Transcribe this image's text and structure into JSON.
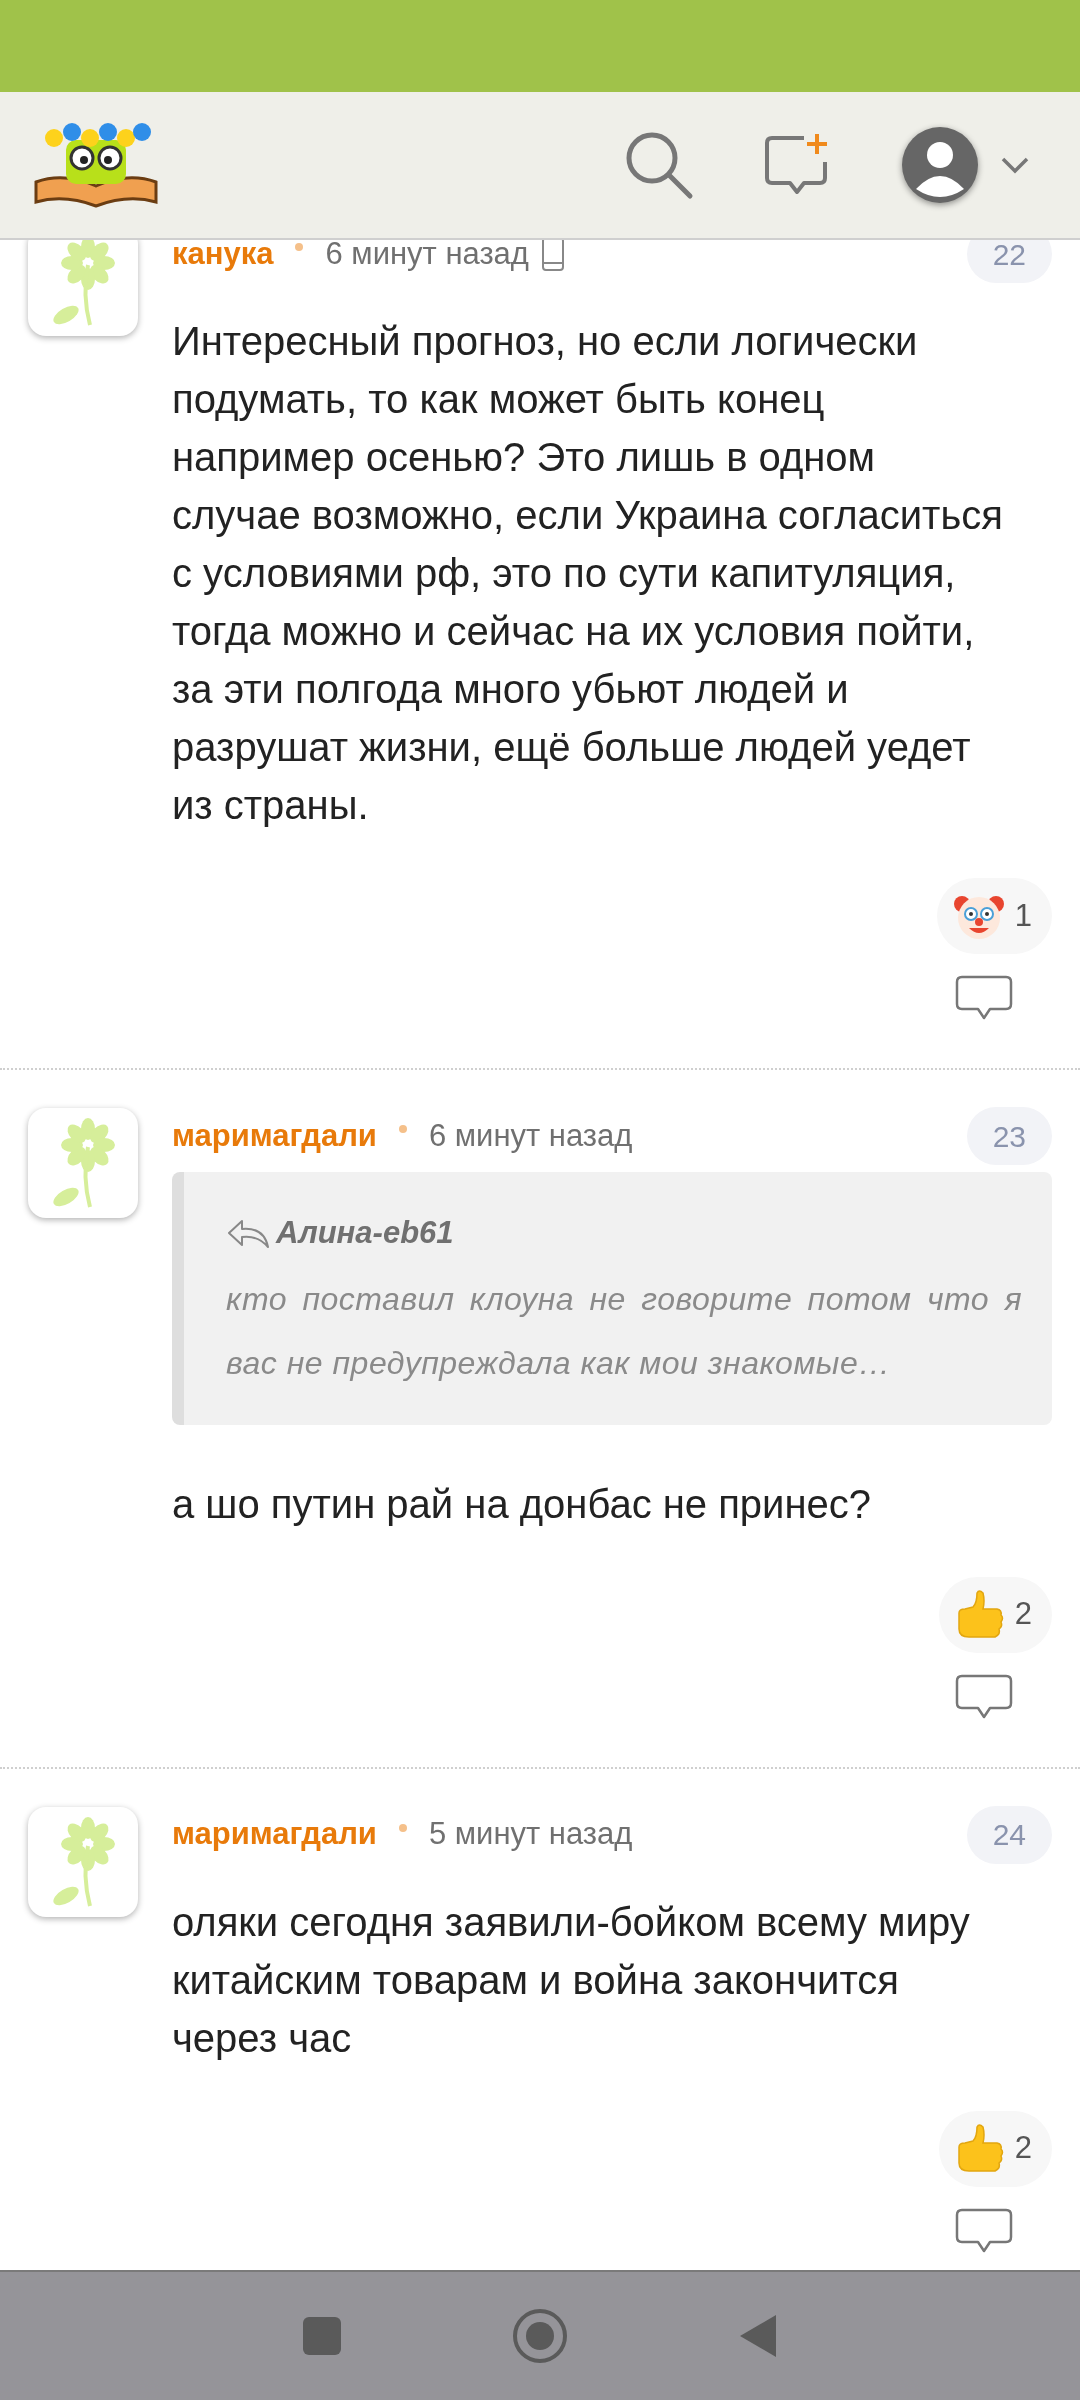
{
  "comments": [
    {
      "author": "канука",
      "time": "6 минут назад",
      "mobile": true,
      "number": "22",
      "text": "Интересный прогноз, но если логически подумать, то как может быть конец например осенью? Это лишь в одном случае возможно, если Украина согласиться с условиями рф, это по сути капитуляция, тогда можно и сейчас на их условия пойти, за эти полгода много убьют людей и разрушат жизни, ещё больше людей уедет из страны.",
      "reaction": {
        "kind": "clown",
        "count": "1"
      }
    },
    {
      "author": "маримагдали",
      "time": "6 минут назад",
      "mobile": false,
      "number": "23",
      "quote": {
        "author": "Алина-eb61",
        "text": "кто поставил клоуна не говорите потом что я вас не предупреждала как мои знакомые…"
      },
      "text": "а шо путин рай на донбас не принес?",
      "reaction": {
        "kind": "thumbs",
        "count": "2"
      }
    },
    {
      "author": "маримагдали",
      "time": "5 минут назад",
      "mobile": false,
      "number": "24",
      "text": "оляки сегодня заявили-бойком всему миру китайским товарам и война закончится через час",
      "reaction": {
        "kind": "thumbs",
        "count": "2"
      }
    }
  ]
}
